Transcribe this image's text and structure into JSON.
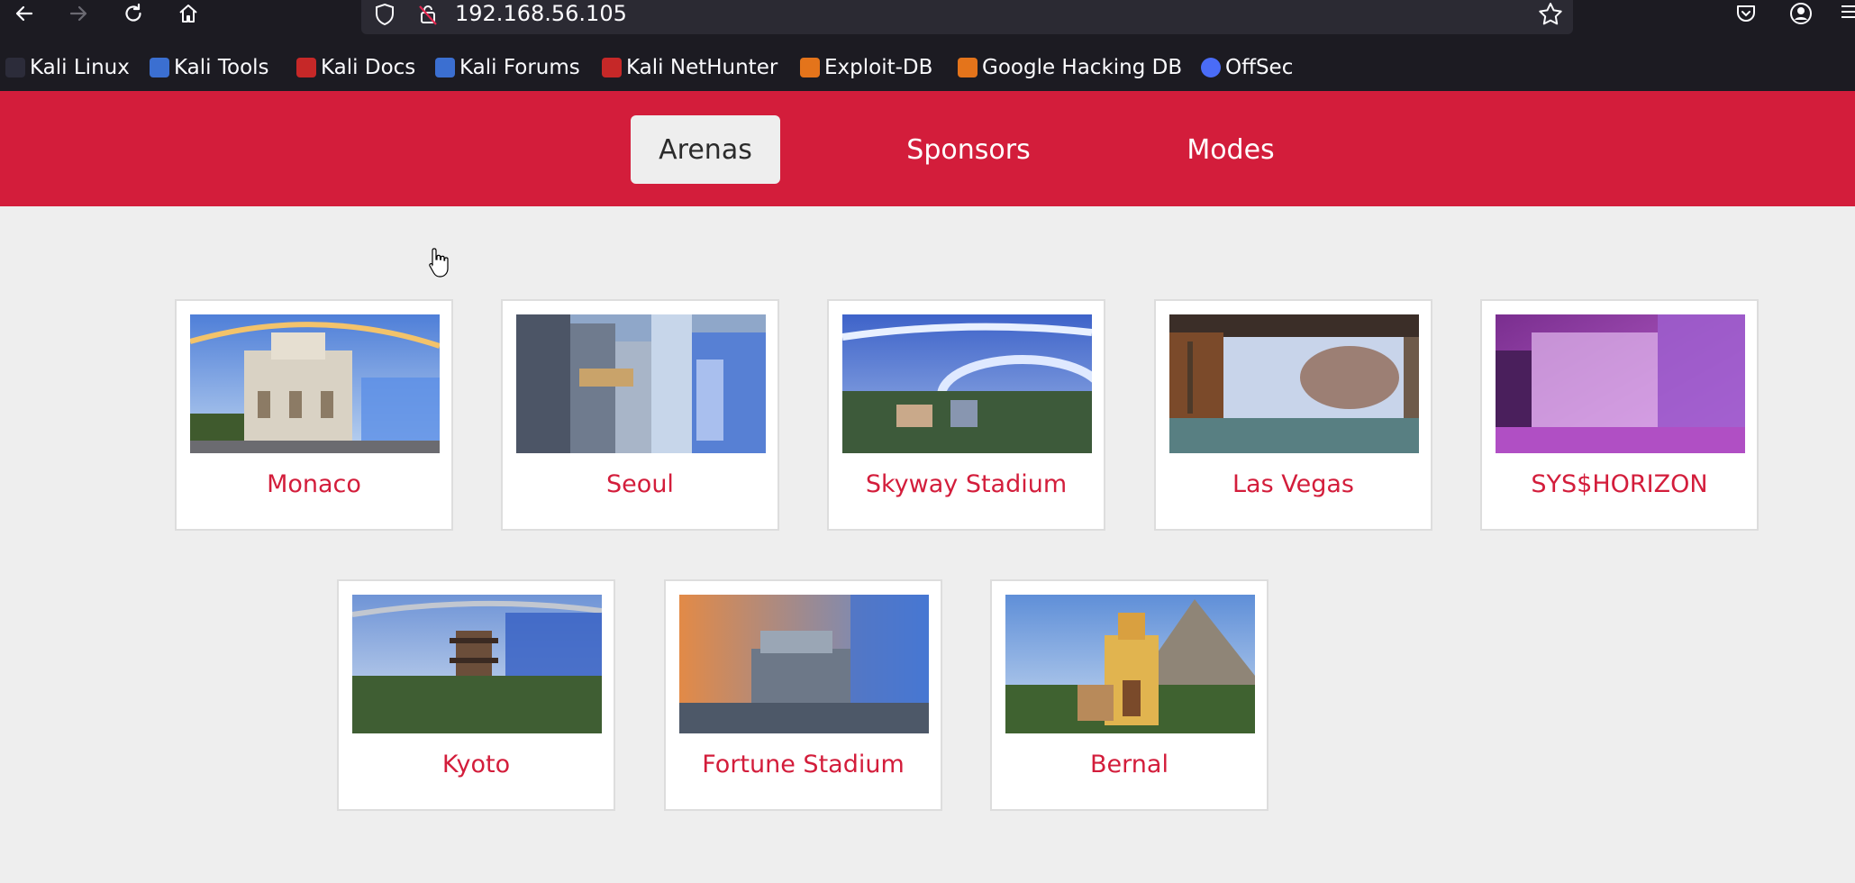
{
  "browser": {
    "url": "192.168.56.105",
    "bookmarks": [
      {
        "label": "Kali Linux",
        "color": "#2c2c3a"
      },
      {
        "label": "Kali Tools",
        "color": "#3b6fd1"
      },
      {
        "label": "Kali Docs",
        "color": "#c62828"
      },
      {
        "label": "Kali Forums",
        "color": "#3b6fd1"
      },
      {
        "label": "Kali NetHunter",
        "color": "#c62828"
      },
      {
        "label": "Exploit-DB",
        "color": "#e4741b"
      },
      {
        "label": "Google Hacking DB",
        "color": "#e4741b"
      },
      {
        "label": "OffSec",
        "color": "#4a6cf7"
      }
    ]
  },
  "nav": {
    "tabs": [
      {
        "label": "Arenas",
        "active": true
      },
      {
        "label": "Sponsors",
        "active": false
      },
      {
        "label": "Modes",
        "active": false
      }
    ],
    "accent": "#d31d3b"
  },
  "arenas": [
    {
      "name": "Monaco"
    },
    {
      "name": "Seoul"
    },
    {
      "name": "Skyway Stadium"
    },
    {
      "name": "Las Vegas"
    },
    {
      "name": "SYS$HORIZON"
    },
    {
      "name": "Kyoto"
    },
    {
      "name": "Fortune Stadium"
    },
    {
      "name": "Bernal"
    }
  ]
}
